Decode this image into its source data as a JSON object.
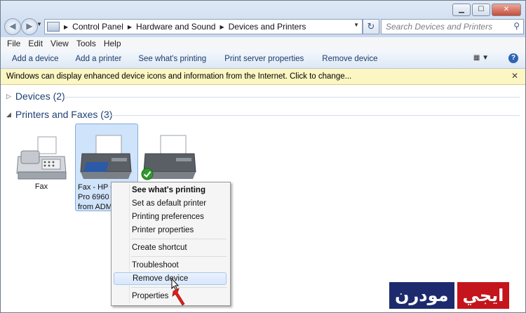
{
  "window": {
    "controls": {
      "minimize": "▁",
      "maximize": "☐",
      "close": "✕"
    }
  },
  "nav": {
    "back": "◀",
    "forward": "▶"
  },
  "address": {
    "breadcrumbs": [
      "Control Panel",
      "Hardware and Sound",
      "Devices and Printers"
    ]
  },
  "search": {
    "placeholder": "Search Devices and Printers"
  },
  "menu": [
    "File",
    "Edit",
    "View",
    "Tools",
    "Help"
  ],
  "commands": [
    "Add a device",
    "Add a printer",
    "See what's printing",
    "Print server properties",
    "Remove device"
  ],
  "infobar": {
    "text": "Windows can display enhanced device icons and information from the Internet. Click to change..."
  },
  "groups": {
    "devices": "Devices (2)",
    "printers": "Printers and Faxes (3)"
  },
  "devices": {
    "fax": "Fax",
    "selected_lines": [
      "Fax - HP O",
      "Pro 6960 v",
      "from ADM"
    ]
  },
  "context_menu": {
    "items": [
      "See what's printing",
      "Set as default printer",
      "Printing preferences",
      "Printer properties",
      "Create shortcut",
      "Troubleshoot",
      "Remove device",
      "Properties"
    ]
  },
  "watermark": {
    "left": "ايجي",
    "right": "مودرن"
  },
  "colors": {
    "accent": "#1e3f74",
    "infobar": "#fbf6c2",
    "selection": "#cfe3fa"
  }
}
